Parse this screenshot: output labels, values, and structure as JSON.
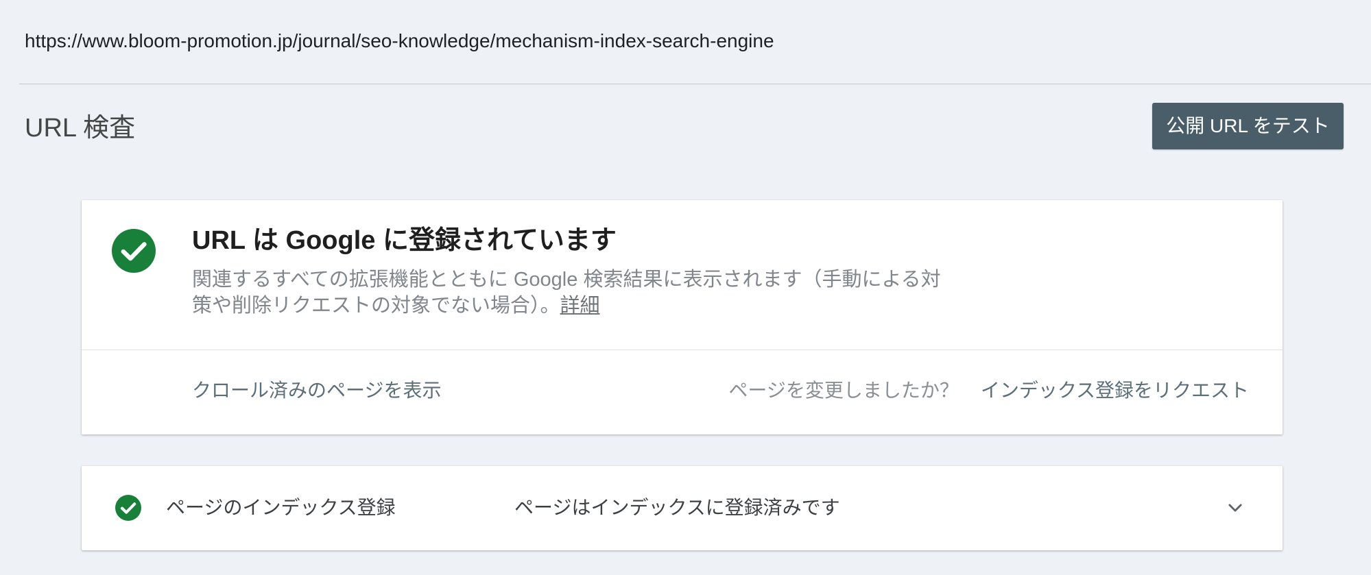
{
  "url_bar": {
    "url": "https://www.bloom-promotion.jp/journal/seo-knowledge/mechanism-index-search-engine"
  },
  "header": {
    "title": "URL 検査",
    "test_button_label": "公開 URL をテスト"
  },
  "status_card": {
    "icon": "check-circle-icon",
    "title": "URL は Google に登録されています",
    "description": "関連するすべての拡張機能とともに Google 検索結果に表示されます（手動による対策や削除リクエストの対象でない場合）。",
    "details_link": "詳細",
    "view_crawled_label": "クロール済みのページを表示",
    "page_changed_prompt": "ページを変更しましたか？",
    "request_indexing_label": "インデックス登録をリクエスト"
  },
  "coverage_card": {
    "icon": "check-circle-icon",
    "label": "ページのインデックス登録",
    "status": "ページはインデックスに登録済みです",
    "expand_icon": "chevron-down-icon"
  },
  "colors": {
    "background": "#eef2f7",
    "button_bg": "#4a5e69",
    "success_green": "#188038"
  }
}
